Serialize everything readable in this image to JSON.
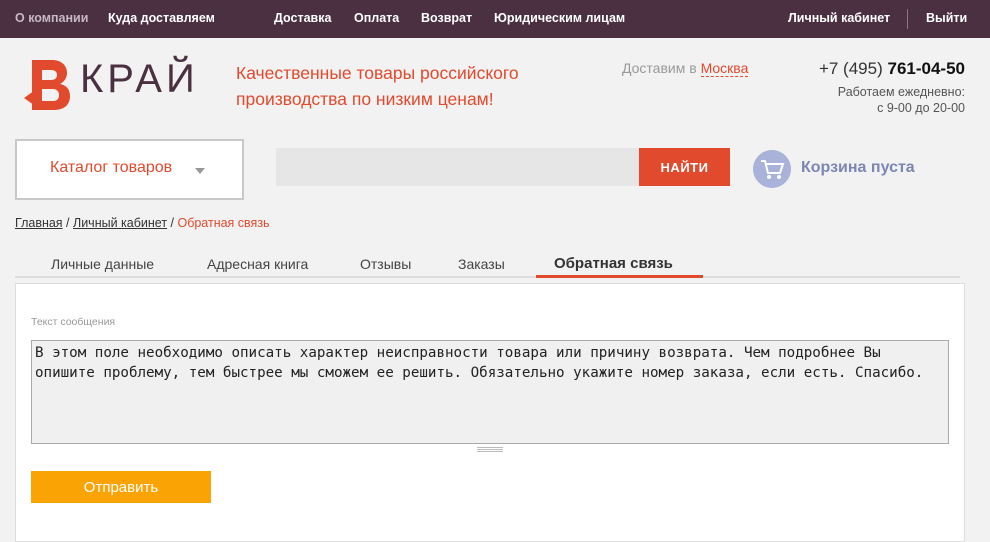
{
  "topnav": {
    "items": [
      "О компании",
      "Куда доставляем",
      "Доставка",
      "Оплата",
      "Возврат",
      "Юридическим лицам"
    ],
    "account": "Личный кабинет",
    "logout": "Выйти"
  },
  "header": {
    "logo_text": "КРАЙ",
    "slogan": "Качественные товары российского производства по низким ценам!",
    "delivery_prefix": "Доставим в",
    "city": "Москва",
    "phone_prefix": "+7 (495)",
    "phone_number": "761-04-50",
    "hours_line1": "Работаем ежедневно:",
    "hours_line2": "с 9-00 до 20-00"
  },
  "search": {
    "catalog_label": "Каталог товаров",
    "placeholder": "",
    "button": "НАЙТИ",
    "cart_label": "Корзина пуста"
  },
  "breadcrumb": {
    "home": "Главная",
    "account": "Личный кабинет",
    "current": "Обратная связь"
  },
  "tabs": [
    "Личные данные",
    "Адресная книга",
    "Отзывы",
    "Заказы",
    "Обратная связь"
  ],
  "form": {
    "label": "Текст сообщения",
    "message": "В этом поле необходимо описать характер неисправности товара или причину возврата. Чем подробнее Вы опишите проблему, тем быстрее мы сможем ее решить. Обязательно укажите номер заказа, если есть. Спасибо.",
    "submit": "Отправить"
  },
  "colors": {
    "accent": "#e14a2d",
    "topbar": "#4a3040",
    "submit": "#f9a305",
    "cart": "#a9b3da"
  }
}
